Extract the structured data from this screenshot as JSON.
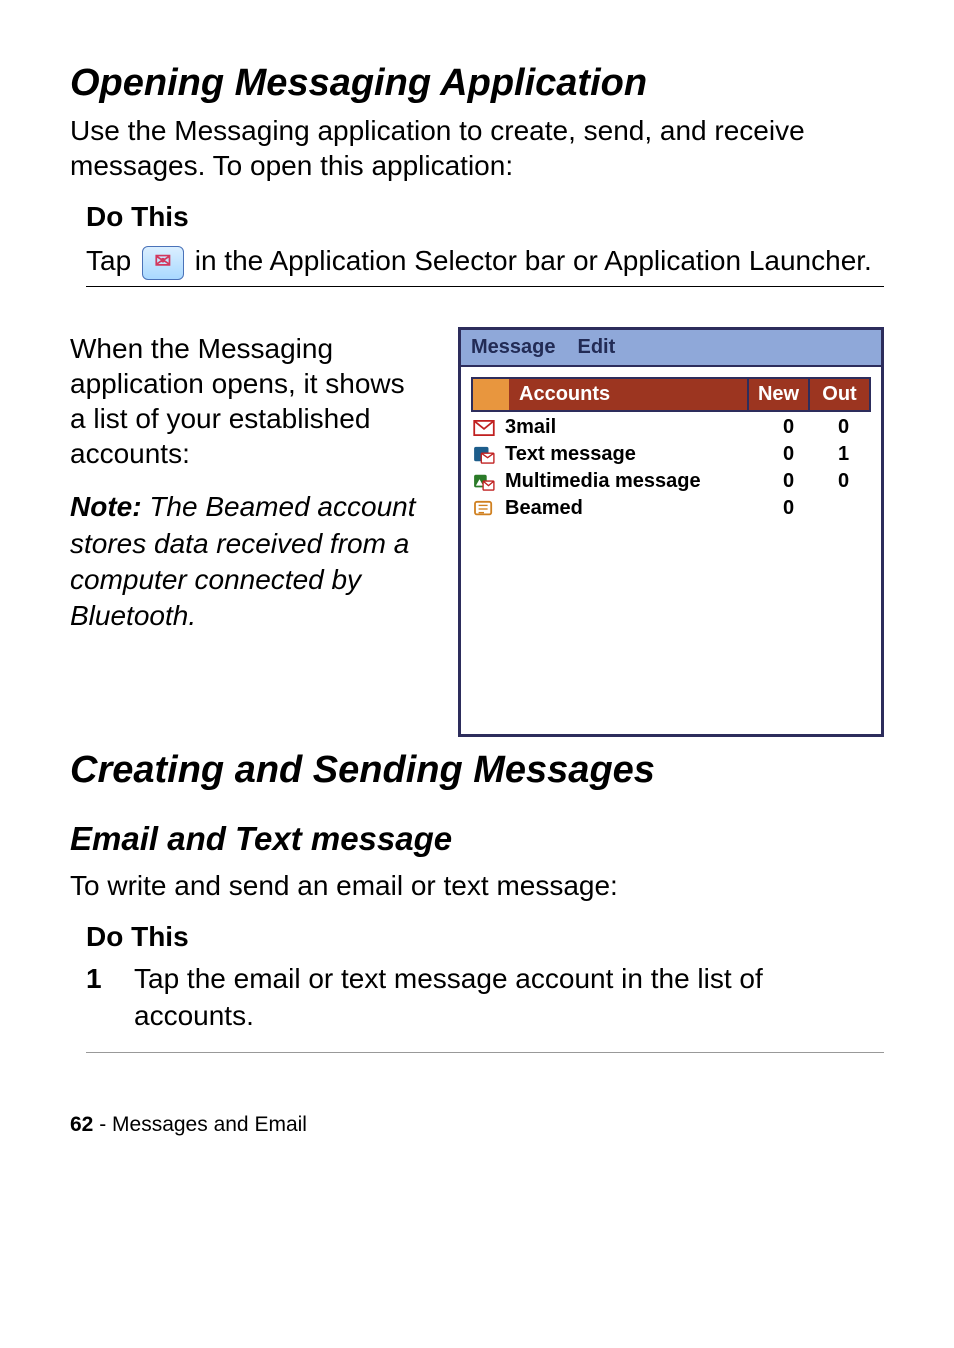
{
  "heading1": "Opening Messaging Application",
  "intro1": "Use the Messaging application to create, send, and receive messages. To open this application:",
  "do_this": "Do This",
  "tap_instruction_pre": "Tap ",
  "tap_instruction_post": " in the Application Selector bar or Application Launcher.",
  "accounts_intro": "When the Messaging application opens, it shows a list of your established accounts:",
  "note_label": "Note: ",
  "note_text": "The Beamed account stores data received from a computer connected by Bluetooth.",
  "device": {
    "menu": {
      "message": "Message",
      "edit": "Edit"
    },
    "header": {
      "accounts": "Accounts",
      "new": "New",
      "out": "Out"
    },
    "rows": [
      {
        "icon": "mail-icon",
        "name": "3mail",
        "new": "0",
        "out": "0"
      },
      {
        "icon": "text-icon",
        "name": "Text message",
        "new": "0",
        "out": "1"
      },
      {
        "icon": "mms-icon",
        "name": "Multimedia message",
        "new": "0",
        "out": "0"
      },
      {
        "icon": "beamed-icon",
        "name": "Beamed",
        "new": "0",
        "out": ""
      }
    ]
  },
  "heading2": "Creating and Sending Messages",
  "heading3": "Email and Text message",
  "intro2": "To write and send an email or text message:",
  "step1_num": "1",
  "step1_text": "Tap the email or text message account in the list of accounts.",
  "footer": {
    "page": "62",
    "sep": " - ",
    "section": "Messages and Email"
  }
}
